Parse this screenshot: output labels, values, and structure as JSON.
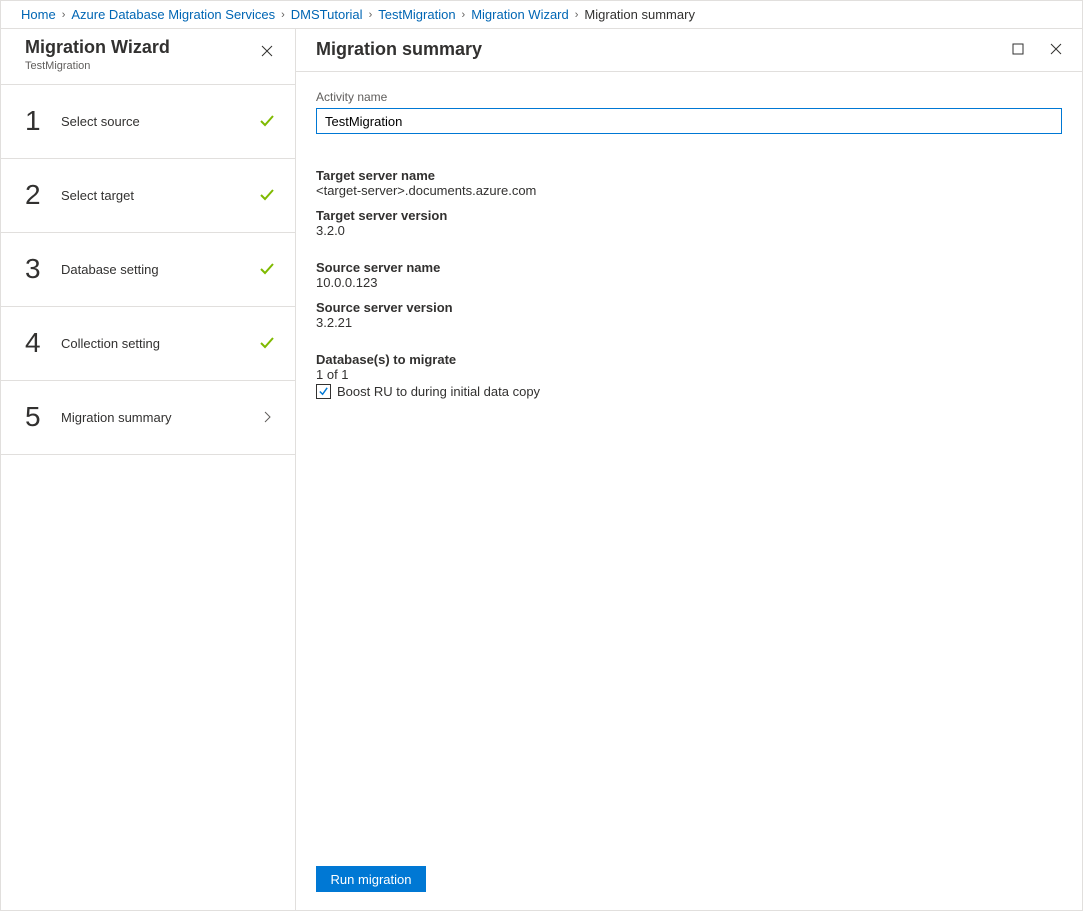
{
  "breadcrumb": {
    "items": [
      {
        "label": "Home"
      },
      {
        "label": "Azure Database Migration Services"
      },
      {
        "label": "DMSTutorial"
      },
      {
        "label": "TestMigration"
      },
      {
        "label": "Migration Wizard"
      }
    ],
    "current": "Migration summary"
  },
  "wizard": {
    "title": "Migration Wizard",
    "subtitle": "TestMigration",
    "steps": [
      {
        "num": "1",
        "label": "Select source",
        "status": "done"
      },
      {
        "num": "2",
        "label": "Select target",
        "status": "done"
      },
      {
        "num": "3",
        "label": "Database setting",
        "status": "done"
      },
      {
        "num": "4",
        "label": "Collection setting",
        "status": "done"
      },
      {
        "num": "5",
        "label": "Migration summary",
        "status": "current"
      }
    ]
  },
  "content": {
    "title": "Migration summary",
    "activity_label": "Activity name",
    "activity_value": "TestMigration",
    "target_server_name_label": "Target server name",
    "target_server_name_value": "<target-server>.documents.azure.com",
    "target_server_version_label": "Target server version",
    "target_server_version_value": "3.2.0",
    "source_server_name_label": "Source server name",
    "source_server_name_value": "10.0.0.123",
    "source_server_version_label": "Source server version",
    "source_server_version_value": "3.2.21",
    "databases_label": "Database(s) to migrate",
    "databases_value": "1 of 1",
    "boost_label": "Boost RU to during initial data copy",
    "boost_checked": true,
    "run_button": "Run migration"
  }
}
